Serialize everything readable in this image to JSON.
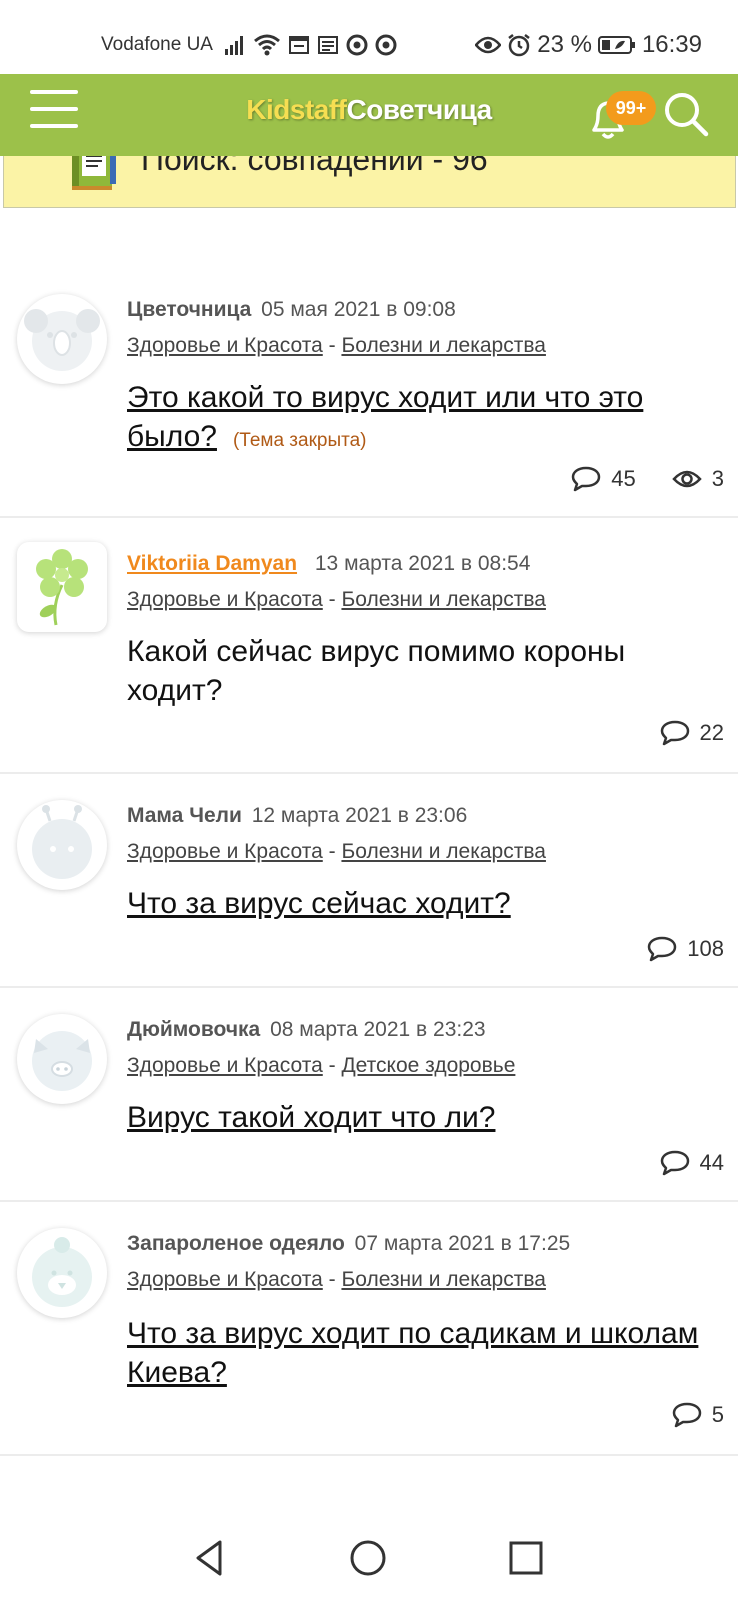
{
  "status_bar": {
    "carrier": "Vodafone UA",
    "battery": "23 %",
    "time": "16:39",
    "icons": [
      "signal-icon",
      "wifi-icon",
      "calendar-icon",
      "news-icon",
      "chrome-icon",
      "chrome-icon",
      "eye-icon",
      "alarm-icon",
      "battery-icon"
    ]
  },
  "header": {
    "brand_part1": "Kidstaff",
    "brand_part2": "Советчица",
    "notification_badge": "99+",
    "accent_color": "#9cc14a",
    "badge_color": "#f39b1c"
  },
  "banner": {
    "text": "Поиск: совпадений - 96"
  },
  "posts": [
    {
      "author": "Цветочница",
      "date": "05 мая 2021 в 09:08",
      "category": "Здоровье и Красота",
      "subcategory": "Болезни и лекарства",
      "title": "Это какой то вирус ходит или что это было?",
      "closed_label": "(Тема закрыта)",
      "comments": "45",
      "views": "3"
    },
    {
      "author": "Viktoriia Damyan",
      "date": "13 марта 2021 в 08:54",
      "category": "Здоровье и Красота",
      "subcategory": "Болезни и лекарства",
      "title": "Какой сейчас вирус помимо короны ходит?",
      "comments": "22"
    },
    {
      "author": "Мама Чели",
      "date": "12 марта 2021 в 23:06",
      "category": "Здоровье и Красота",
      "subcategory": "Болезни и лекарства",
      "title": "Что за вирус сейчас ходит?",
      "comments": "108"
    },
    {
      "author": "Дюймовочка",
      "date": "08 марта 2021 в 23:23",
      "category": "Здоровье и Красота",
      "subcategory": "Детское здоровье",
      "title": "Вирус такой ходит что ли?",
      "comments": "44"
    },
    {
      "author": "Запароленое одеяло",
      "date": "07 марта 2021 в 17:25",
      "category": "Здоровье и Красота",
      "subcategory": "Болезни и лекарства",
      "title": "Что за вирус ходит по садикам и школам Киева?",
      "comments": "5"
    }
  ],
  "separator": "-",
  "nav": {
    "buttons": [
      "back-icon",
      "home-icon",
      "recents-icon"
    ]
  }
}
